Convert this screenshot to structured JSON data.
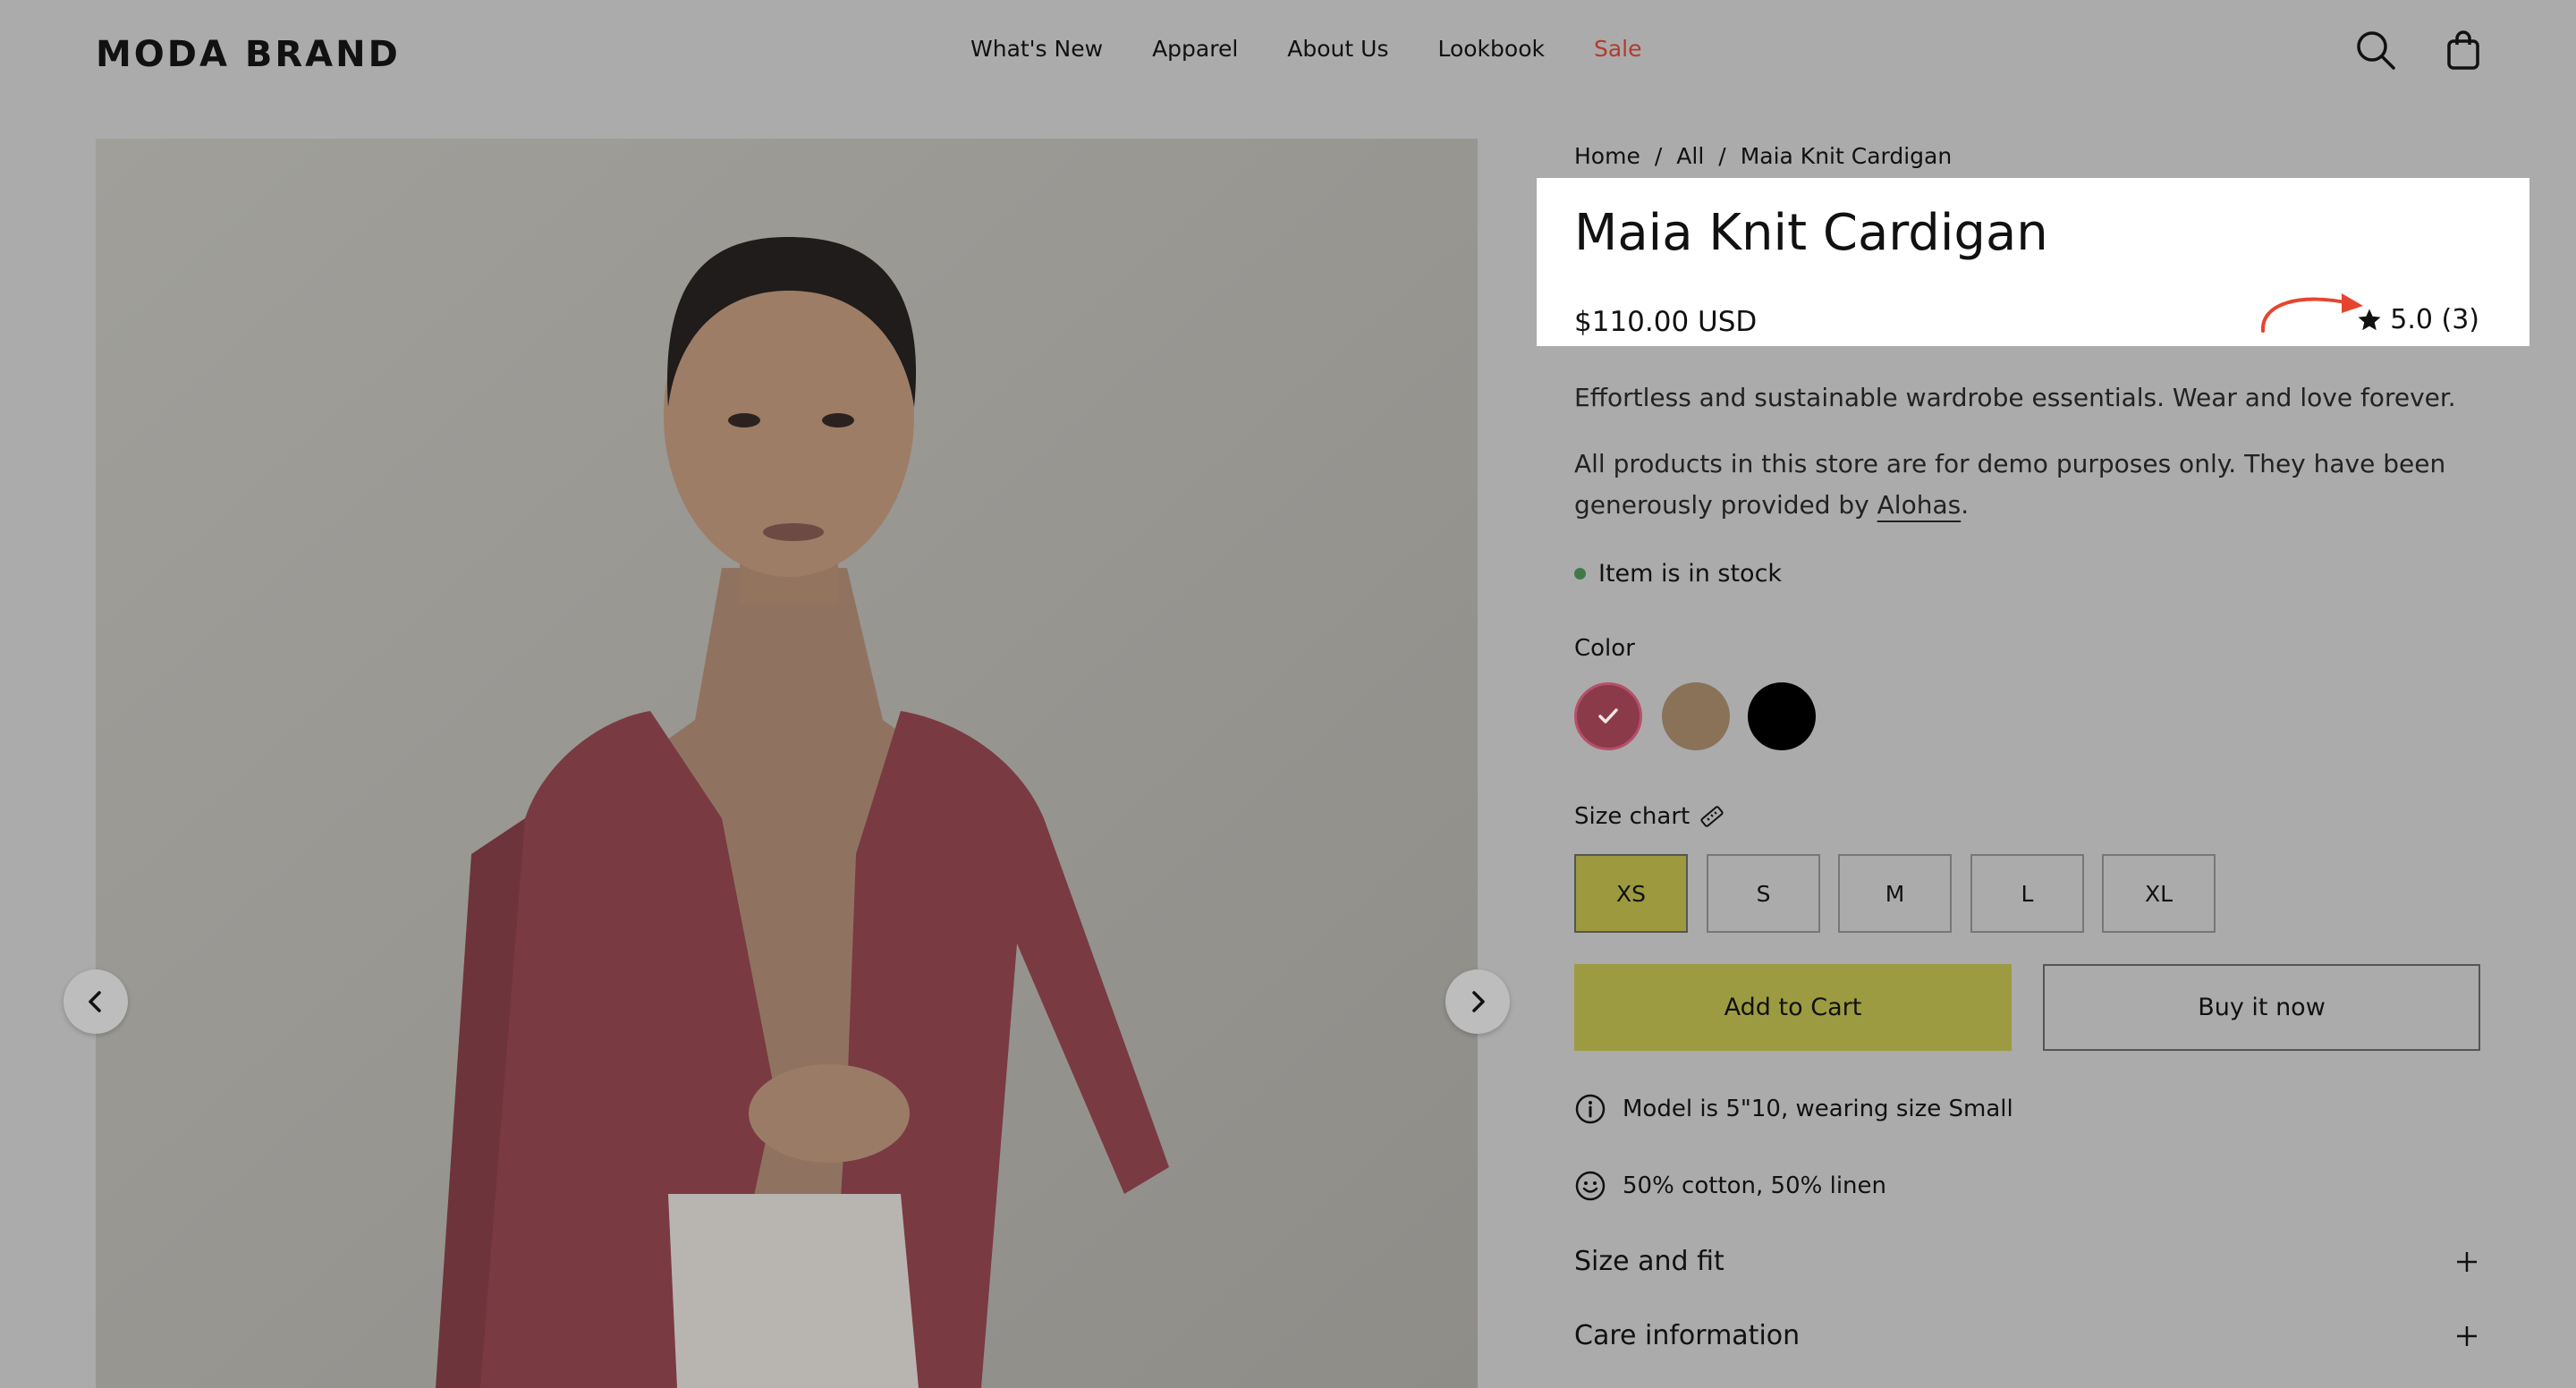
{
  "header": {
    "logo": "MODA BRAND",
    "nav": [
      "What's New",
      "Apparel",
      "About Us",
      "Lookbook",
      "Sale"
    ],
    "icons": [
      "search-icon",
      "shopping-bag-icon"
    ]
  },
  "breadcrumb": [
    "Home",
    "All",
    "Maia Knit Cardigan"
  ],
  "breadcrumb_sep": "/",
  "product": {
    "title": "Maia Knit Cardigan",
    "price": "$110.00 USD",
    "rating": "5.0 (3)",
    "desc1": "Effortless and sustainable wardrobe essentials. Wear and love forever.",
    "desc2_line1": "All products in this store are for demo purposes only. They have been",
    "desc2_line2_prefix": "generously provided by ",
    "desc2_link": "Alohas",
    "desc2_suffix": ".",
    "stock": "Item is in stock",
    "color_label": "Color",
    "colors": [
      "#8b3a4a",
      "#8a7259",
      "#000000"
    ],
    "size_chart_label": "Size chart",
    "sizes": [
      "XS",
      "S",
      "M",
      "L",
      "XL"
    ],
    "selected_size": "XS",
    "add_to_cart": "Add to Cart",
    "buy_now": "Buy it now",
    "model_info": "Model is 5\"10, wearing size Small",
    "material": "50% cotton, 50% linen",
    "accordion": [
      "Size and fit",
      "Care information"
    ]
  },
  "colors": {
    "highlight_arrow": "#e5452f",
    "stock_dot": "#3f7a48",
    "sale": "#b33b2e"
  }
}
